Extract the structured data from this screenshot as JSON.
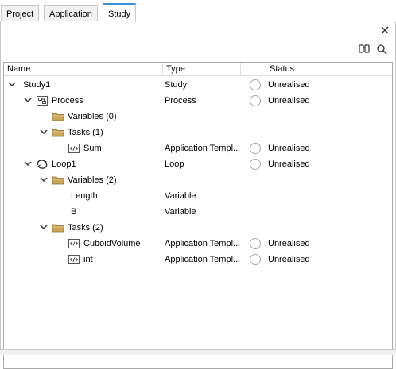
{
  "tabs": [
    {
      "label": "Project",
      "active": false
    },
    {
      "label": "Application",
      "active": false
    },
    {
      "label": "Study",
      "active": true
    }
  ],
  "toolbar": {
    "icons": [
      "close-icon",
      "find-icon",
      "search-icon"
    ]
  },
  "table": {
    "columns": [
      "Name",
      "Type",
      "",
      "Status"
    ],
    "rows": [
      {
        "name": "Study1",
        "type": "Study",
        "status": "Unrealised",
        "icon": "none",
        "expand": "expanded"
      },
      {
        "name": "Process",
        "type": "Process",
        "status": "Unrealised",
        "icon": "process-icon",
        "expand": "expanded"
      },
      {
        "name": "Variables (0)",
        "type": "",
        "status": "",
        "icon": "folder-icon",
        "expand": "none"
      },
      {
        "name": "Tasks (1)",
        "type": "",
        "status": "",
        "icon": "folder-icon",
        "expand": "expanded"
      },
      {
        "name": "Sum",
        "type": "Application Templ...",
        "status": "Unrealised",
        "icon": "code-icon",
        "expand": "none"
      },
      {
        "name": "Loop1",
        "type": "Loop",
        "status": "Unrealised",
        "icon": "loop-icon",
        "expand": "expanded"
      },
      {
        "name": "Variables (2)",
        "type": "",
        "status": "",
        "icon": "folder-icon",
        "expand": "expanded"
      },
      {
        "name": "Length",
        "type": "Variable",
        "status": "",
        "icon": "none",
        "expand": "none"
      },
      {
        "name": "B",
        "type": "Variable",
        "status": "",
        "icon": "none",
        "expand": "none"
      },
      {
        "name": "Tasks (2)",
        "type": "",
        "status": "",
        "icon": "folder-icon",
        "expand": "expanded"
      },
      {
        "name": "CuboidVolume",
        "type": "Application Templ...",
        "status": "Unrealised",
        "icon": "code-icon",
        "expand": "none"
      },
      {
        "name": "int",
        "type": "Application Templ...",
        "status": "Unrealised",
        "icon": "code-icon",
        "expand": "none"
      }
    ]
  },
  "colors": {
    "active_tab_accent": "#3c8cd8",
    "folder": "#caa55a",
    "border": "#a8a8a8"
  }
}
